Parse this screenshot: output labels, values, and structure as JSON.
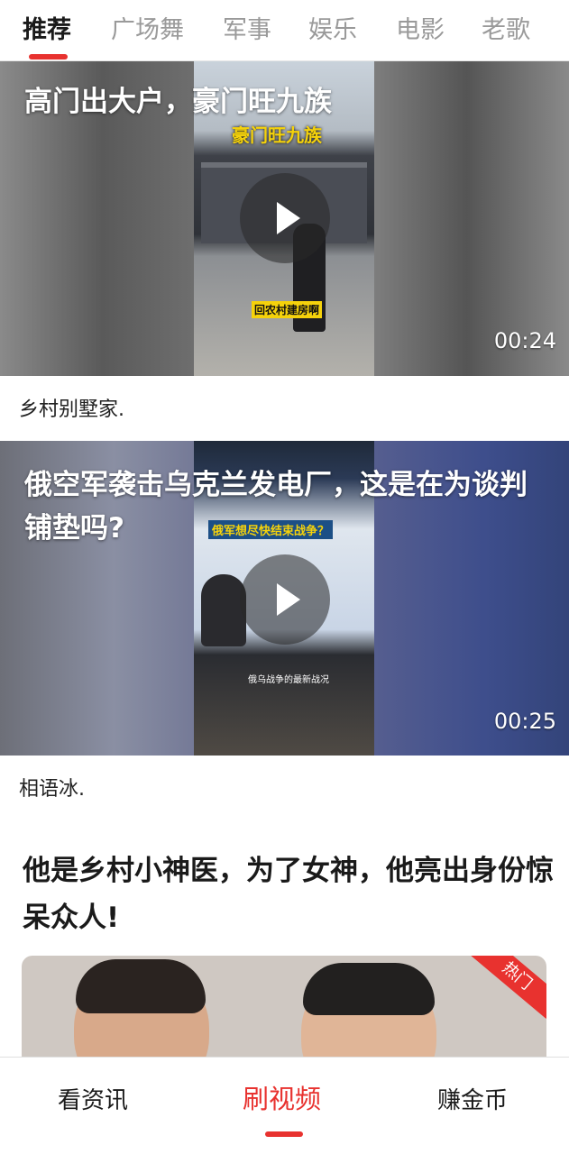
{
  "top_tabs": [
    {
      "label": "推荐",
      "active": true
    },
    {
      "label": "广场舞",
      "active": false
    },
    {
      "label": "军事",
      "active": false
    },
    {
      "label": "娱乐",
      "active": false
    },
    {
      "label": "电影",
      "active": false
    },
    {
      "label": "老歌",
      "active": false
    }
  ],
  "feed": {
    "videos": [
      {
        "title": "高门出大户，豪门旺九族",
        "thumb_caption_1": "豪门旺九族",
        "thumb_caption_2": "回农村建房啊",
        "duration": "00:24",
        "author": "乡村别墅家."
      },
      {
        "title": "俄空军袭击乌克兰发电厂，这是在为谈判铺垫吗?",
        "thumb_caption_1": "俄军想尽快结束战争？",
        "thumb_caption_2": "俄乌战争的最新战况",
        "duration": "00:25",
        "author": "相语冰."
      }
    ],
    "article": {
      "title": "他是乡村小神医，为了女神，他亮出身份惊呆众人!",
      "badge": "热门"
    }
  },
  "bottom_nav": [
    {
      "label": "看资讯",
      "active": false
    },
    {
      "label": "刷视频",
      "active": true
    },
    {
      "label": "赚金币",
      "active": false
    }
  ],
  "colors": {
    "accent": "#e8322f",
    "tab_inactive": "#9a9a9a",
    "text": "#1a1a1a"
  },
  "icons": {
    "play": "play-icon"
  }
}
